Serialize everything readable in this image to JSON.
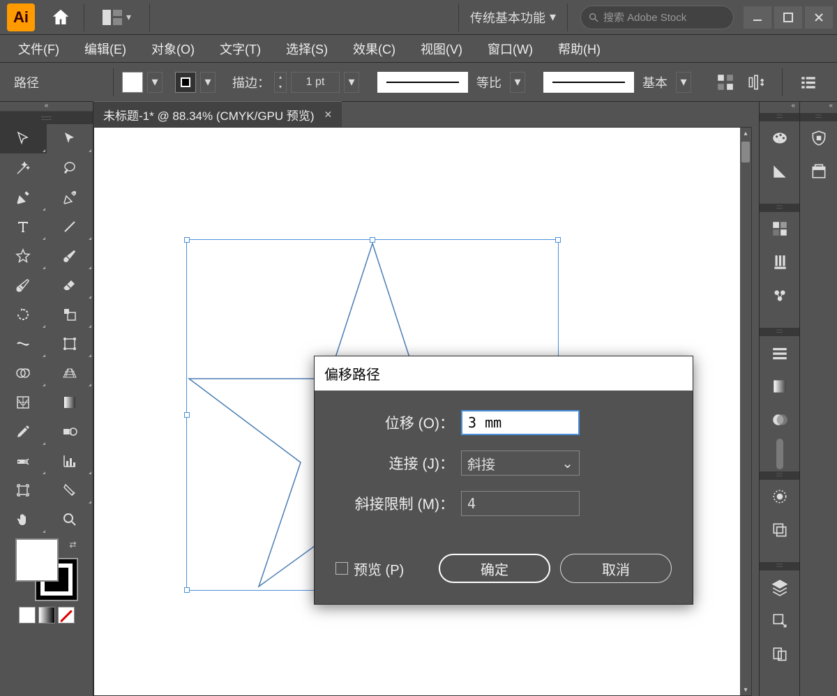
{
  "titlebar": {
    "logo": "Ai",
    "workspace": "传统基本功能",
    "search_placeholder": "搜索 Adobe Stock"
  },
  "menu": {
    "file": "文件(F)",
    "edit": "编辑(E)",
    "object": "对象(O)",
    "type": "文字(T)",
    "select": "选择(S)",
    "effect": "效果(C)",
    "view": "视图(V)",
    "window": "窗口(W)",
    "help": "帮助(H)"
  },
  "control": {
    "path_label": "路径",
    "stroke_label": "描边：",
    "stroke_value": "1 pt",
    "prop_label": "等比",
    "basic_label": "基本"
  },
  "document": {
    "tab_title": "未标题-1* @ 88.34% (CMYK/GPU 预览)"
  },
  "dialog": {
    "title": "偏移路径",
    "offset_label": "位移 (O)：",
    "offset_value": "3 mm",
    "join_label": "连接 (J)：",
    "join_value": "斜接",
    "miter_label": "斜接限制 (M)：",
    "miter_value": "4",
    "preview_label": "预览 (P)",
    "ok": "确定",
    "cancel": "取消"
  }
}
